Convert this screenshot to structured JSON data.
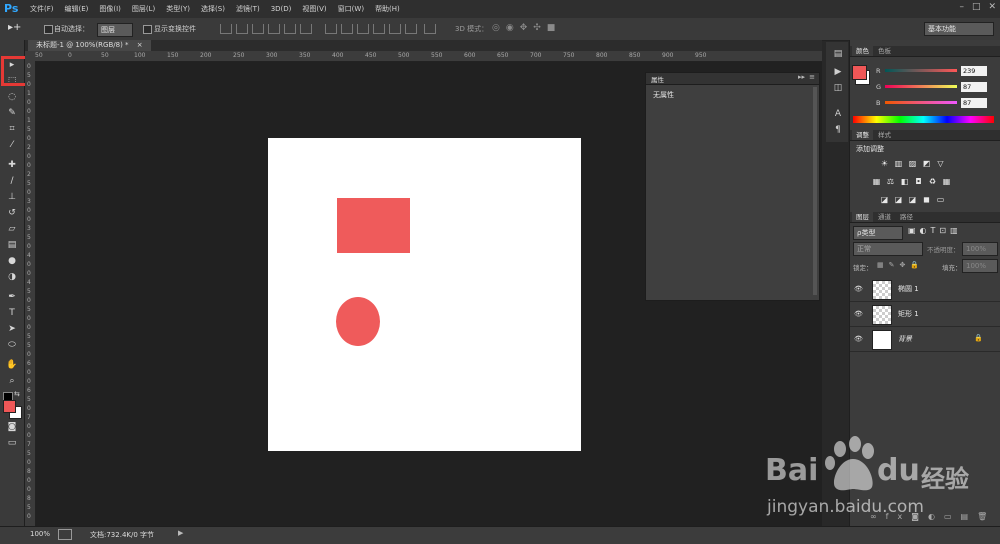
{
  "app": {
    "logo": "Ps"
  },
  "menus": [
    "文件(F)",
    "编辑(E)",
    "图像(I)",
    "图层(L)",
    "类型(Y)",
    "选择(S)",
    "滤镜(T)",
    "3D(D)",
    "视图(V)",
    "窗口(W)",
    "帮助(H)"
  ],
  "window_controls": [
    "–",
    "□",
    "✕"
  ],
  "options": {
    "auto_select_label": "自动选择：",
    "auto_select_value": "图层",
    "show_transform_label": "显示变换控件",
    "mode_3d_label": "3D 模式：",
    "workspace": "基本功能"
  },
  "document": {
    "tab_title": "未标题-1 @ 100%(RGB/8) *",
    "close": "×",
    "shape_color": "#ef5b5b",
    "background": "#ffffff"
  },
  "rulers": {
    "h_ticks": [
      "50",
      "0",
      "50",
      "100",
      "150",
      "200",
      "250",
      "300",
      "350",
      "400",
      "450",
      "500",
      "550",
      "600",
      "650",
      "700",
      "750",
      "800",
      "850",
      "900",
      "950"
    ],
    "v_ticks": [
      "0",
      "5",
      "0",
      "1",
      "0",
      "0",
      "1",
      "5",
      "0",
      "2",
      "0",
      "0",
      "2",
      "5",
      "0",
      "3",
      "0",
      "0",
      "3",
      "5",
      "0",
      "4",
      "0",
      "0",
      "4",
      "5",
      "0",
      "5",
      "0",
      "0",
      "5",
      "5",
      "0",
      "6",
      "0",
      "0",
      "6",
      "5",
      "0",
      "7",
      "0",
      "0",
      "7",
      "5",
      "0",
      "8",
      "0",
      "0",
      "8",
      "5",
      "0"
    ]
  },
  "properties": {
    "title": "属性",
    "content": "无属性"
  },
  "color_panel": {
    "tabs": [
      "颜色",
      "色板"
    ],
    "r_label": "R",
    "g_label": "G",
    "b_label": "B",
    "r": "239",
    "g": "87",
    "b": "87",
    "fg": "#ef5757",
    "bg": "#ffffff"
  },
  "adjust_panel": {
    "tabs": [
      "调整",
      "样式"
    ],
    "title": "添加调整"
  },
  "layers_panel": {
    "tabs": [
      "图层",
      "通道",
      "路径"
    ],
    "filter_label": "ρ类型",
    "blend_mode": "正常",
    "opacity_label": "不透明度：",
    "opacity": "100%",
    "lock_label": "锁定：",
    "fill_label": "填充：",
    "fill": "100%",
    "layers": [
      {
        "name": "椭圆 1",
        "eye": "👁"
      },
      {
        "name": "矩形 1",
        "eye": "👁"
      },
      {
        "name": "背景",
        "eye": "👁",
        "lock": "🔒"
      }
    ]
  },
  "status": {
    "zoom": "100%",
    "doc_info": "文档:732.4K/0 字节"
  },
  "watermark": {
    "brand": "Bai",
    "brand2": "du",
    "cn": "经验",
    "url": "jingyan.baidu.com"
  }
}
